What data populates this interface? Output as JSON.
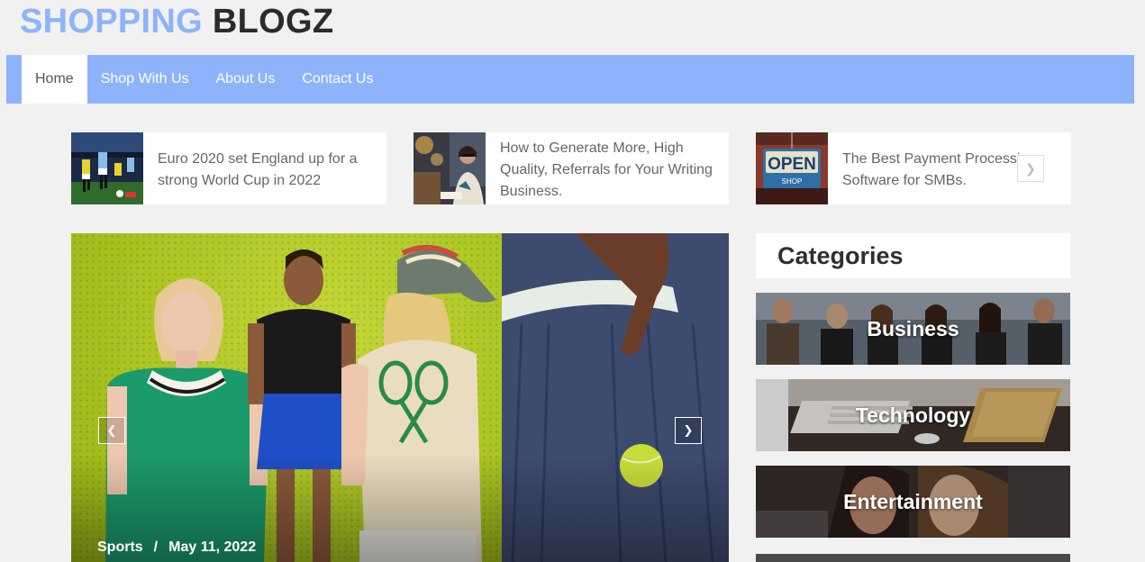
{
  "site": {
    "logo_part1": "SHOPPING",
    "logo_part2": "BLOGZ"
  },
  "nav": {
    "items": [
      {
        "label": "Home"
      },
      {
        "label": "Shop With Us"
      },
      {
        "label": "About Us"
      },
      {
        "label": "Contact Us"
      }
    ]
  },
  "ticker": {
    "items": [
      {
        "title": "Euro 2020 set England up for a strong World Cup in 2022"
      },
      {
        "title": "How to Generate More, High Quality, Referrals for Your Writing Business."
      },
      {
        "title": "The Best Payment Processing Software for SMBs."
      }
    ],
    "open_sign": "OPEN",
    "shop_sign": "SHOP"
  },
  "slider": {
    "category": "Sports",
    "separator": "/",
    "date": "May 11, 2022"
  },
  "sidebar": {
    "title": "Categories",
    "categories": [
      {
        "label": "Business"
      },
      {
        "label": "Technology"
      },
      {
        "label": "Entertainment"
      }
    ]
  },
  "colors": {
    "accent": "#8db3fb",
    "background": "#f1f1f1"
  }
}
